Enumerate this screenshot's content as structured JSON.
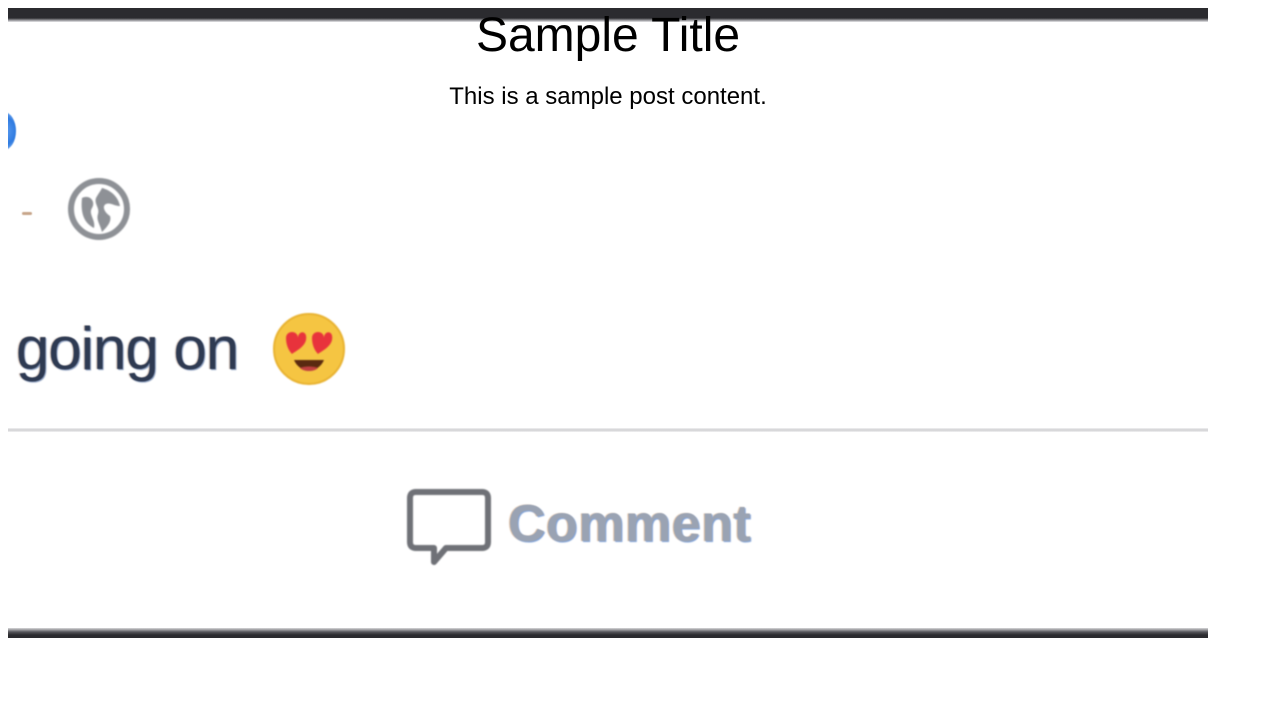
{
  "header": {
    "title": "Sample Title",
    "subtitle": "This is a sample post content."
  },
  "post": {
    "text": "going on",
    "emoji_name": "heart-eyes-emoji",
    "privacy_icon": "globe-icon"
  },
  "actions": {
    "comment_label": "Comment",
    "comment_icon": "comment-bubble-icon"
  },
  "colors": {
    "accent_blue": "#2f7be0",
    "text_dark": "#2e3a52",
    "action_gray": "#9aa3b3",
    "bar_dark": "#2b2b2f"
  }
}
